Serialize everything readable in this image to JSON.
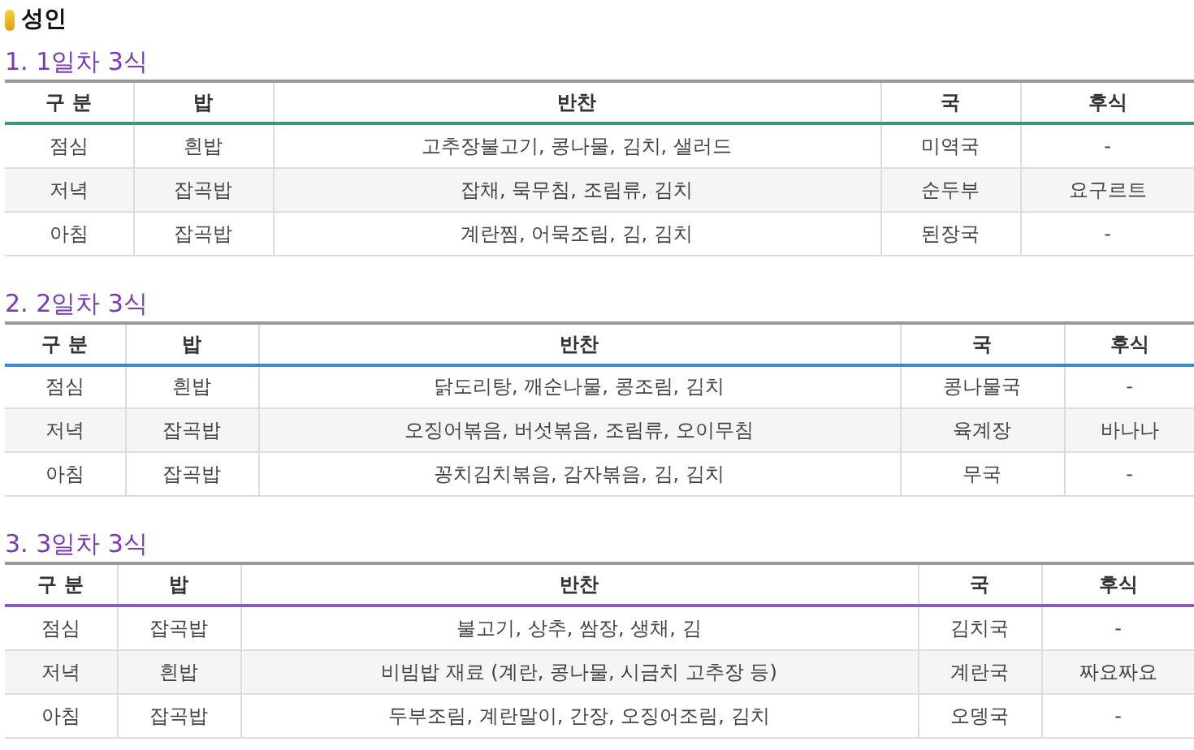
{
  "title": "성인",
  "sections": [
    {
      "heading": "1. 1일차 3식",
      "color": "#3a9a6a",
      "columns": [
        "구 분",
        "밥",
        "반찬",
        "국",
        "후식"
      ],
      "rows": [
        [
          "점심",
          "흰밥",
          "고추장불고기, 콩나물, 김치, 샐러드",
          "미역국",
          "-"
        ],
        [
          "저녁",
          "잡곡밥",
          "잡채, 묵무침, 조림류, 김치",
          "순두부",
          "요구르트"
        ],
        [
          "아침",
          "잡곡밥",
          "계란찜, 어묵조림, 김, 김치",
          "된장국",
          "-"
        ]
      ]
    },
    {
      "heading": "2. 2일차 3식",
      "color": "#3a8ad0",
      "columns": [
        "구 분",
        "밥",
        "반찬",
        "국",
        "후식"
      ],
      "rows": [
        [
          "점심",
          "흰밥",
          "닭도리탕, 깨순나물, 콩조림, 김치",
          "콩나물국",
          "-"
        ],
        [
          "저녁",
          "잡곡밥",
          "오징어볶음, 버섯볶음, 조림류, 오이무침",
          "육계장",
          "바나나"
        ],
        [
          "아침",
          "잡곡밥",
          "꽁치김치볶음, 감자볶음, 김, 김치",
          "무국",
          "-"
        ]
      ]
    },
    {
      "heading": "3. 3일차 3식",
      "color": "#8a5ac8",
      "columns": [
        "구 분",
        "밥",
        "반찬",
        "국",
        "후식"
      ],
      "rows": [
        [
          "점심",
          "잡곡밥",
          "불고기, 상추, 쌈장, 생채, 김",
          "김치국",
          "-"
        ],
        [
          "저녁",
          "흰밥",
          "비빔밥 재료 (계란, 콩나물, 시금치 고추장 등)",
          "계란국",
          "짜요짜요"
        ],
        [
          "아침",
          "잡곡밥",
          "두부조림, 계란말이, 간장, 오징어조림, 김치",
          "오뎅국",
          "-"
        ]
      ]
    }
  ]
}
